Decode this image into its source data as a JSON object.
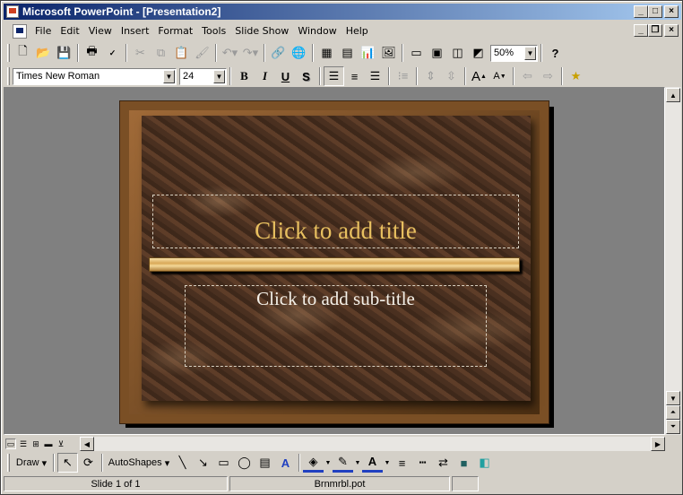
{
  "window": {
    "title": "Microsoft PowerPoint - [Presentation2]"
  },
  "menu": {
    "items": [
      "File",
      "Edit",
      "View",
      "Insert",
      "Format",
      "Tools",
      "Slide Show",
      "Window",
      "Help"
    ]
  },
  "standard_toolbar": {
    "zoom": "50%"
  },
  "formatting_toolbar": {
    "font": "Times New Roman",
    "size": "24"
  },
  "slide": {
    "title_placeholder": "Click to add title",
    "subtitle_placeholder": "Click to add sub-title"
  },
  "drawing_toolbar": {
    "draw_label": "Draw",
    "autoshapes_label": "AutoShapes"
  },
  "status": {
    "slide_position": "Slide 1 of 1",
    "design_template": "Brnmrbl.pot"
  },
  "colors": {
    "title_text": "#e8c060",
    "subtitle_text": "#f4f0e8",
    "titlebar_start": "#0a246a",
    "titlebar_end": "#a6caf0"
  }
}
